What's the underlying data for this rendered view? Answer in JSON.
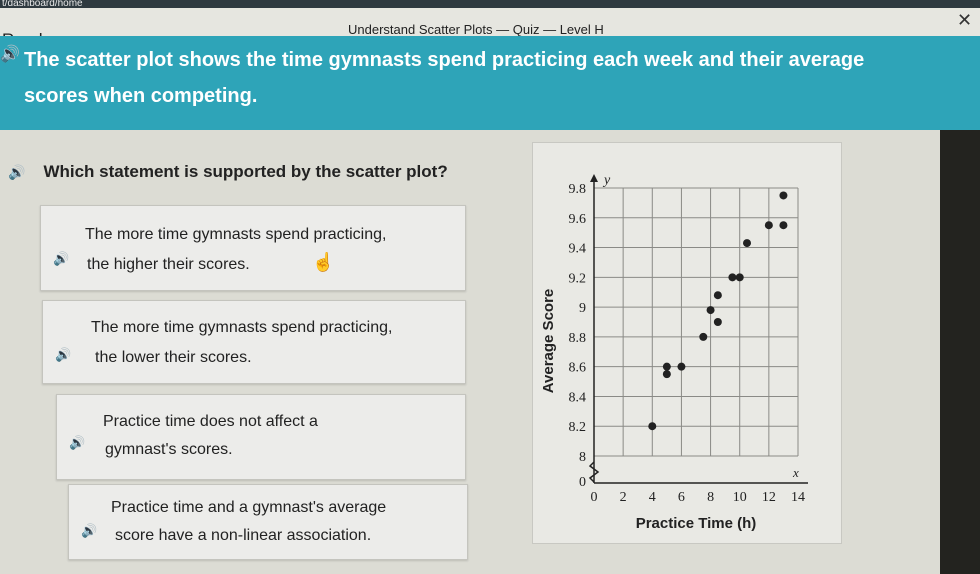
{
  "browser": {
    "url_fragment": "t/dashboard/home"
  },
  "header": {
    "status": "Ready",
    "quiz_title": "Understand Scatter Plots — Quiz — Level H",
    "close_icon": "close-icon"
  },
  "banner": {
    "audio_icon": "speaker-icon",
    "text": "The scatter plot shows the time gymnasts spend practicing each week and their average scores when competing."
  },
  "question": {
    "audio_icon": "speaker-icon",
    "text": "Which statement is supported by the scatter plot?"
  },
  "options": [
    {
      "line1": "The more time gymnasts spend practicing,",
      "line2": "the higher their scores."
    },
    {
      "line1": "The more time gymnasts spend practicing,",
      "line2": "the lower their scores."
    },
    {
      "line1": "Practice time does not affect a",
      "line2": "gymnast's scores."
    },
    {
      "line1": "Practice time and a gymnast's average",
      "line2": "score have a non-linear association."
    }
  ],
  "colors": {
    "accent": "#2ea4b8",
    "point": "#222222"
  },
  "chart_data": {
    "type": "scatter",
    "xlabel": "Practice Time (h)",
    "ylabel": "Average Score",
    "x_var": "x",
    "y_var": "y",
    "x_ticks": [
      "0",
      "2",
      "4",
      "6",
      "8",
      "10",
      "12",
      "14"
    ],
    "y_ticks": [
      "0",
      "8",
      "8.2",
      "8.4",
      "8.6",
      "8.8",
      "9",
      "9.2",
      "9.4",
      "9.6",
      "9.8"
    ],
    "xlim": [
      0,
      14
    ],
    "ylim": [
      8,
      9.8
    ],
    "y_axis_break": true,
    "grid": true,
    "points": [
      {
        "x": 4,
        "y": 8.2
      },
      {
        "x": 5,
        "y": 8.55
      },
      {
        "x": 5,
        "y": 8.6
      },
      {
        "x": 6,
        "y": 8.6
      },
      {
        "x": 7.5,
        "y": 8.8
      },
      {
        "x": 8,
        "y": 8.98
      },
      {
        "x": 8.5,
        "y": 8.9
      },
      {
        "x": 8.5,
        "y": 9.08
      },
      {
        "x": 9.5,
        "y": 9.2
      },
      {
        "x": 10,
        "y": 9.2
      },
      {
        "x": 10.5,
        "y": 9.43
      },
      {
        "x": 12,
        "y": 9.55
      },
      {
        "x": 13,
        "y": 9.55
      },
      {
        "x": 13,
        "y": 9.75
      }
    ]
  }
}
